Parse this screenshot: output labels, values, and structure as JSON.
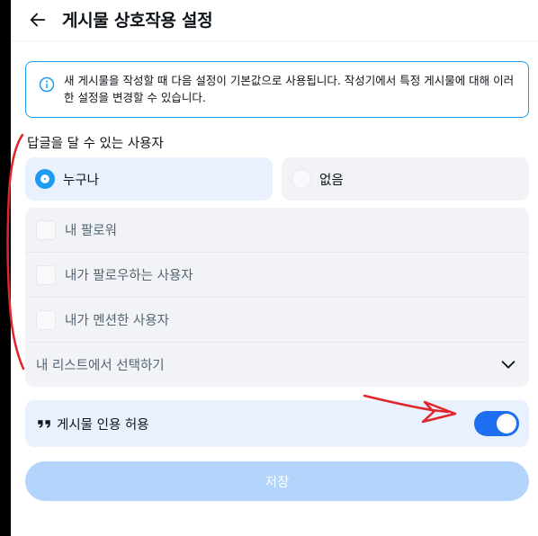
{
  "header": {
    "title": "게시물 상호작용 설정",
    "back_icon": "arrow-left-icon"
  },
  "info": {
    "icon": "info-icon",
    "text": "새 게시물을 작성할 때 다음 설정이 기본값으로 사용됩니다. 작성기에서 특정 게시물에 대해 이러한 설정을 변경할 수 있습니다."
  },
  "reply": {
    "section_label": "답글을 달 수 있는 사용자",
    "everyone_label": "누구나",
    "nobody_label": "없음",
    "selected": "everyone",
    "options": [
      {
        "label": "내 팔로워",
        "checked": false
      },
      {
        "label": "내가 팔로우하는 사용자",
        "checked": false
      },
      {
        "label": "내가 멘션한 사용자",
        "checked": false
      }
    ],
    "list_label": "내 리스트에서 선택하기"
  },
  "quote": {
    "icon": "quote-icon",
    "label": "게시물 인용 허용",
    "enabled": true
  },
  "save_label": "저장",
  "colors": {
    "accent": "#1d9bf0",
    "toggle_on": "#1d6ff0",
    "save_disabled": "#b3d4fb",
    "annotation": "#e0262a"
  }
}
